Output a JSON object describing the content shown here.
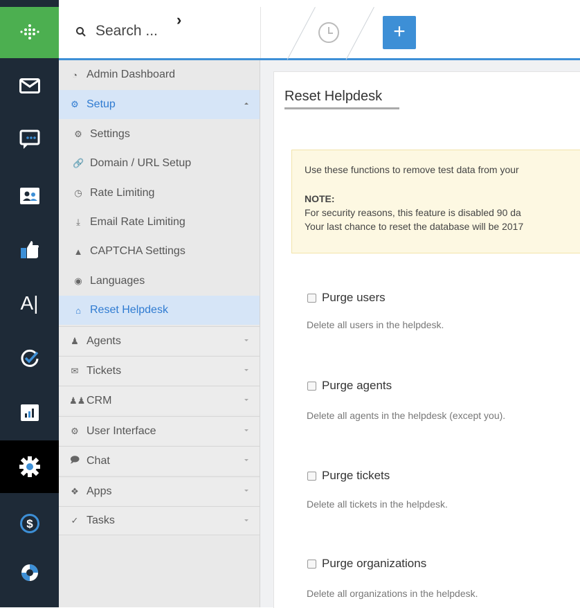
{
  "topbar": {
    "search_label": "Search ...",
    "add_label": "+"
  },
  "rail": {
    "logo_color": "#4caf50",
    "items": [
      {
        "name": "mail-icon"
      },
      {
        "name": "chat-bubble-icon"
      },
      {
        "name": "contacts-icon"
      },
      {
        "name": "thumbs-up-icon"
      },
      {
        "name": "text-cursor-icon",
        "glyph": "A|"
      },
      {
        "name": "tasks-check-icon"
      },
      {
        "name": "reports-chart-icon"
      },
      {
        "name": "admin-gear-icon",
        "active": true
      },
      {
        "name": "billing-dollar-icon"
      },
      {
        "name": "support-lifebuoy-icon"
      }
    ]
  },
  "sidebar": {
    "admin_dashboard": "Admin Dashboard",
    "setup": "Setup",
    "setup_items": [
      "Settings",
      "Domain / URL Setup",
      "Rate Limiting",
      "Email Rate Limiting",
      "CAPTCHA Settings",
      "Languages",
      "Reset Helpdesk"
    ],
    "groups": [
      "Agents",
      "Tickets",
      "CRM",
      "User Interface",
      "Chat",
      "Apps",
      "Tasks"
    ]
  },
  "main": {
    "title": "Reset Helpdesk",
    "notice": {
      "line1": "Use these functions to remove test data from your",
      "heading": "NOTE:",
      "line2": "For security reasons, this feature is disabled 90 da",
      "line3": "Your last chance to reset the database will be 2017"
    },
    "options": [
      {
        "label": "Purge users",
        "description": "Delete all users in the helpdesk.",
        "checked": false
      },
      {
        "label": "Purge agents",
        "description": "Delete all agents in the helpdesk (except you).",
        "checked": false
      },
      {
        "label": "Purge tickets",
        "description": "Delete all tickets in the helpdesk.",
        "checked": false
      },
      {
        "label": "Purge organizations",
        "description": "Delete all organizations in the helpdesk.",
        "checked": false
      }
    ]
  },
  "colors": {
    "accent": "#3d8fd6",
    "rail": "#1e2a37",
    "active_nav": "#2f7bd1",
    "notice_bg": "#fdf8e2"
  }
}
